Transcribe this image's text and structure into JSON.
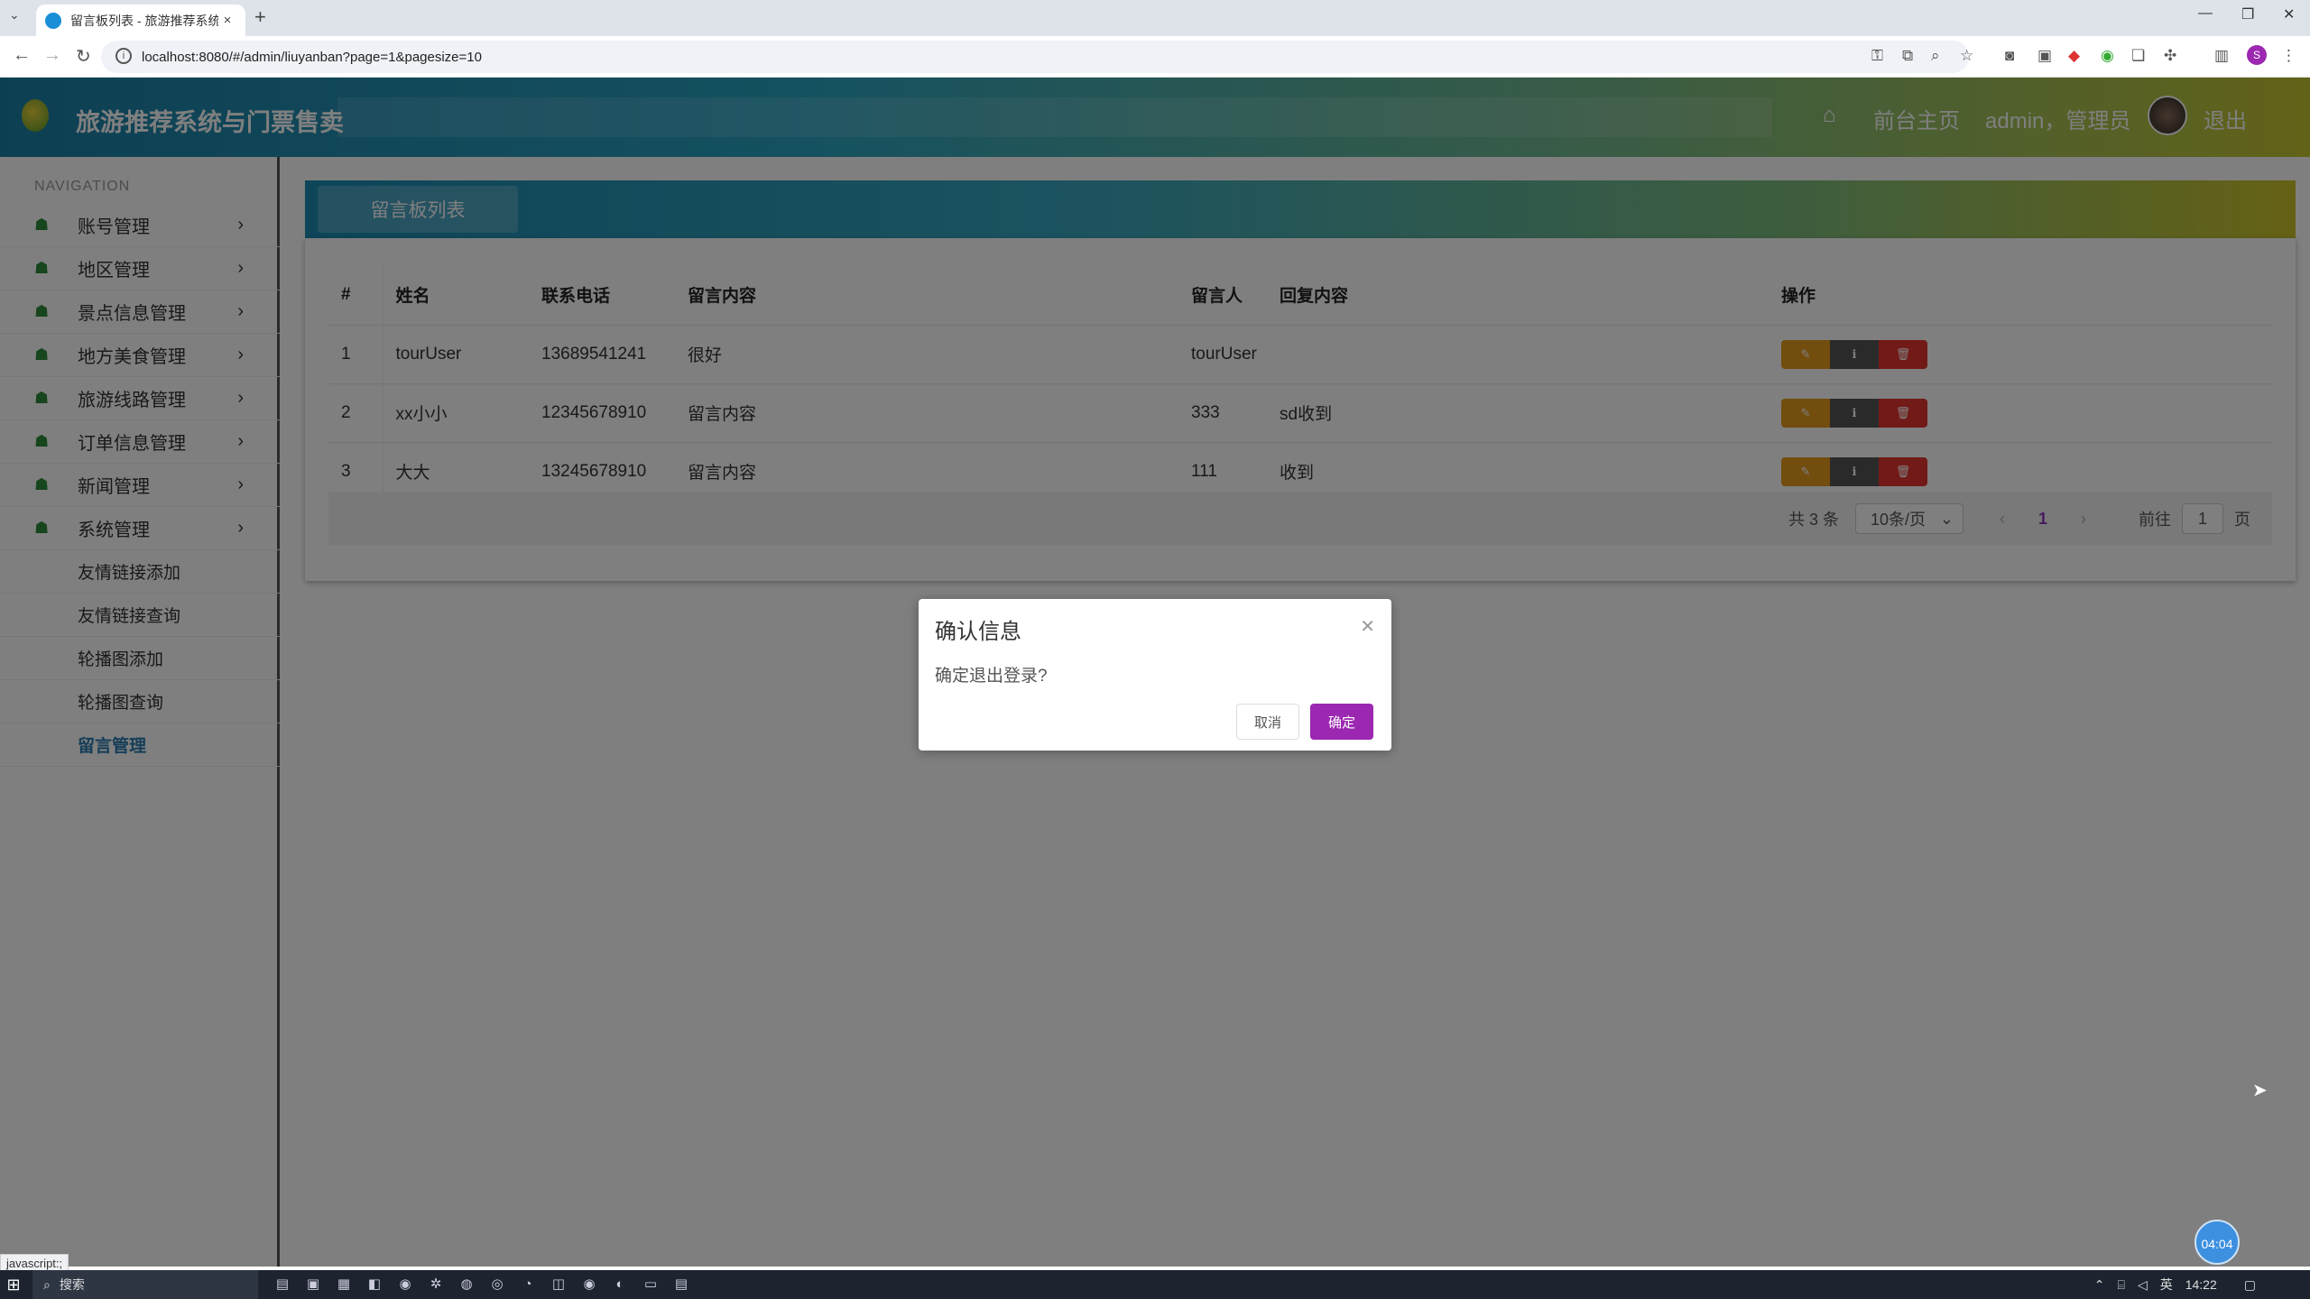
{
  "browser": {
    "tab_title": "留言板列表 - 旅游推荐系统与门",
    "tab_close": "×",
    "new_tab": "+",
    "url": "localhost:8080/#/admin/liuyanban?page=1&pagesize=10",
    "profile_initial": "S"
  },
  "header": {
    "site_name": "旅游推荐系统与门票售卖",
    "front_home": "前台主页",
    "user": "admin，管理员",
    "logout": "退出"
  },
  "sidebar": {
    "nav_title": "NAVIGATION",
    "menus": [
      {
        "label": "账号管理"
      },
      {
        "label": "地区管理"
      },
      {
        "label": "景点信息管理"
      },
      {
        "label": "地方美食管理"
      },
      {
        "label": "旅游线路管理"
      },
      {
        "label": "订单信息管理"
      },
      {
        "label": "新闻管理"
      },
      {
        "label": "系统管理"
      }
    ],
    "subs": [
      {
        "label": "友情链接添加"
      },
      {
        "label": "友情链接查询"
      },
      {
        "label": "轮播图添加"
      },
      {
        "label": "轮播图查询"
      },
      {
        "label": "留言管理"
      }
    ]
  },
  "panel": {
    "title": "留言板列表"
  },
  "table": {
    "headers": [
      "#",
      "姓名",
      "联系电话",
      "留言内容",
      "留言人",
      "回复内容",
      "操作"
    ],
    "rows": [
      {
        "id": "1",
        "name": "tourUser",
        "phone": "13689541241",
        "content": "很好",
        "author": "tourUser",
        "reply": ""
      },
      {
        "id": "2",
        "name": "xx小小",
        "phone": "12345678910",
        "content": "留言内容",
        "author": "333",
        "reply": "sd收到"
      },
      {
        "id": "3",
        "name": "大大",
        "phone": "13245678910",
        "content": "留言内容",
        "author": "111",
        "reply": "收到"
      }
    ]
  },
  "pager": {
    "total": "共 3 条",
    "page_size": "10条/页",
    "current": "1",
    "goto_label": "前往",
    "goto_value": "1",
    "page_unit": "页"
  },
  "dialog": {
    "title": "确认信息",
    "message": "确定退出登录?",
    "cancel": "取消",
    "ok": "确定"
  },
  "status_bar": "javascript:;",
  "timer": "04:04",
  "taskbar": {
    "search": "搜索",
    "ime": "英",
    "time": "14:22"
  }
}
